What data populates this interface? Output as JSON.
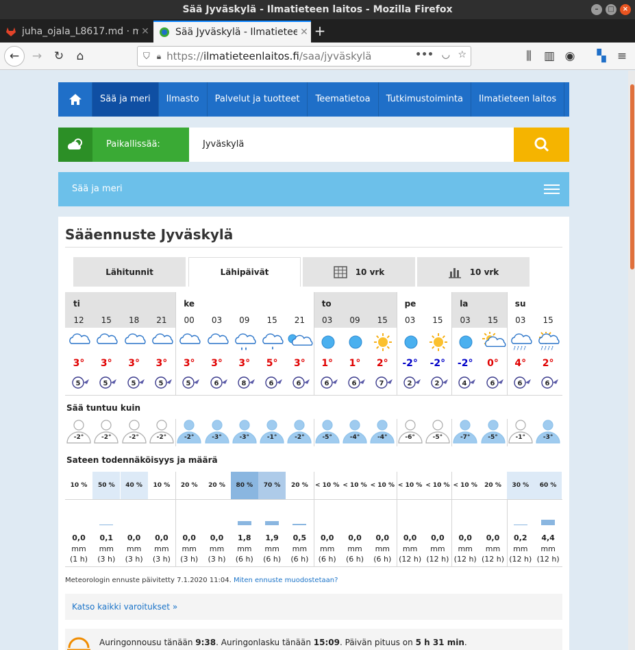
{
  "window": {
    "title": "Sää Jyväskylä - Ilmatieteen laitos - Mozilla Firefox"
  },
  "tabs": [
    {
      "label": "juha_ojala_L8617.md · m"
    },
    {
      "label": "Sää Jyväskylä - Ilmatieteen"
    }
  ],
  "url": {
    "prefix": "https://",
    "host": "ilmatieteenlaitos.fi",
    "path": "/saa/jyväskylä"
  },
  "nav": [
    "Sää ja meri",
    "Ilmasto",
    "Palvelut ja tuotteet",
    "Teematietoa",
    "Tutkimustoiminta",
    "Ilmatieteen laitos"
  ],
  "search": {
    "label": "Paikallissää:",
    "value": "Jyväskylä"
  },
  "section_bar": "Sää ja meri",
  "heading": "Sääennuste Jyväskylä",
  "view_tabs": [
    "Lähitunnit",
    "Lähipäivät",
    "10 vrk",
    "10 vrk"
  ],
  "days": [
    {
      "name": "ti",
      "hours": [
        "12",
        "15",
        "18",
        "21"
      ]
    },
    {
      "name": "ke",
      "hours": [
        "00",
        "03",
        "09",
        "15",
        "21"
      ]
    },
    {
      "name": "to",
      "hours": [
        "03",
        "09",
        "15"
      ]
    },
    {
      "name": "pe",
      "hours": [
        "03",
        "15"
      ]
    },
    {
      "name": "la",
      "hours": [
        "03",
        "15"
      ]
    },
    {
      "name": "su",
      "hours": [
        "03",
        "15"
      ]
    }
  ],
  "columns": [
    {
      "icon": "cloud",
      "temp": "3°",
      "wind": "5",
      "feel": "-2°",
      "feelcol": "#fff",
      "prob": "10 %",
      "amt": "0,0",
      "per": "(1 h)",
      "hi": false,
      "bar": 0
    },
    {
      "icon": "cloud",
      "temp": "3°",
      "wind": "5",
      "feel": "-2°",
      "feelcol": "#fff",
      "prob": "50 %",
      "amt": "0,1",
      "per": "(3 h)",
      "hi": "#ddeaf7",
      "bar": 1
    },
    {
      "icon": "cloud",
      "temp": "3°",
      "wind": "5",
      "feel": "-2°",
      "feelcol": "#fff",
      "prob": "40 %",
      "amt": "0,0",
      "per": "(3 h)",
      "hi": "#ddeaf7",
      "bar": 0
    },
    {
      "icon": "cloud",
      "temp": "3°",
      "wind": "5",
      "feel": "-2°",
      "feelcol": "#fff",
      "prob": "10 %",
      "amt": "0,0",
      "per": "(3 h)",
      "hi": false,
      "bar": 0
    },
    {
      "icon": "cloud",
      "temp": "3°",
      "wind": "5",
      "feel": "-2°",
      "feelcol": "#9fcbef",
      "prob": "20 %",
      "amt": "0,0",
      "per": "(3 h)",
      "hi": false,
      "bar": 0
    },
    {
      "icon": "cloud",
      "temp": "3°",
      "wind": "6",
      "feel": "-3°",
      "feelcol": "#9fcbef",
      "prob": "20 %",
      "amt": "0,0",
      "per": "(3 h)",
      "hi": false,
      "bar": 0
    },
    {
      "icon": "cloud-rain",
      "temp": "3°",
      "wind": "8",
      "feel": "-3°",
      "feelcol": "#9fcbef",
      "prob": "80 %",
      "amt": "1,8",
      "per": "(6 h)",
      "hi": "#8ab6e0",
      "bar": 6
    },
    {
      "icon": "cloud-drop",
      "temp": "5°",
      "wind": "6",
      "feel": "-1°",
      "feelcol": "#9fcbef",
      "prob": "70 %",
      "amt": "1,9",
      "per": "(6 h)",
      "hi": "#aecbe9",
      "bar": 6
    },
    {
      "icon": "moon-cloud",
      "temp": "3°",
      "wind": "6",
      "feel": "-2°",
      "feelcol": "#9fcbef",
      "prob": "20 %",
      "amt": "0,5",
      "per": "(6 h)",
      "hi": false,
      "bar": 2
    },
    {
      "icon": "moon",
      "temp": "1°",
      "wind": "6",
      "feel": "-5°",
      "feelcol": "#9fcbef",
      "prob": "< 10 %",
      "amt": "0,0",
      "per": "(6 h)",
      "hi": false,
      "bar": 0
    },
    {
      "icon": "moon",
      "temp": "1°",
      "wind": "6",
      "feel": "-4°",
      "feelcol": "#9fcbef",
      "prob": "< 10 %",
      "amt": "0,0",
      "per": "(6 h)",
      "hi": false,
      "bar": 0
    },
    {
      "icon": "sun",
      "temp": "2°",
      "wind": "7",
      "feel": "-4°",
      "feelcol": "#9fcbef",
      "prob": "< 10 %",
      "amt": "0,0",
      "per": "(6 h)",
      "hi": false,
      "bar": 0
    },
    {
      "icon": "moon",
      "temp": "-2°",
      "wind": "2",
      "feel": "-6°",
      "feelcol": "#fff",
      "prob": "< 10 %",
      "amt": "0,0",
      "per": "(12 h)",
      "hi": false,
      "bar": 0
    },
    {
      "icon": "sun",
      "temp": "-2°",
      "wind": "2",
      "feel": "-5°",
      "feelcol": "#fff",
      "prob": "< 10 %",
      "amt": "0,0",
      "per": "(12 h)",
      "hi": false,
      "bar": 0
    },
    {
      "icon": "moon",
      "temp": "-2°",
      "wind": "4",
      "feel": "-7°",
      "feelcol": "#9fcbef",
      "prob": "< 10 %",
      "amt": "0,0",
      "per": "(12 h)",
      "hi": false,
      "bar": 0
    },
    {
      "icon": "sun-cloud",
      "temp": "0°",
      "wind": "6",
      "feel": "-5°",
      "feelcol": "#9fcbef",
      "prob": "20 %",
      "amt": "0,0",
      "per": "(12 h)",
      "hi": false,
      "bar": 0
    },
    {
      "icon": "cloud-snow",
      "temp": "4°",
      "wind": "6",
      "feel": "-1°",
      "feelcol": "#fff",
      "prob": "30 %",
      "amt": "0,2",
      "per": "(12 h)",
      "hi": "#ddeaf7",
      "bar": 1
    },
    {
      "icon": "sun-cloud-rain",
      "temp": "2°",
      "wind": "6",
      "feel": "-3°",
      "feelcol": "#9fcbef",
      "prob": "60 %",
      "amt": "4,4",
      "per": "(12 h)",
      "hi": "#ddeaf7",
      "bar": 8
    }
  ],
  "sections": {
    "feels": "Sää tuntuu kuin",
    "precip": "Sateen todennäköisyys ja määrä"
  },
  "mm": "mm",
  "updated": "Meteorologin ennuste päivitetty 7.1.2020 11:04.",
  "updated_link": "Miten ennuste muodostetaan?",
  "warnings_link": "Katso kaikki varoitukset »",
  "sun": {
    "rise_label": "Auringonnousu tänään",
    "rise": "9:38",
    "set_label": ". Auringonlasku tänään",
    "set": "15:09",
    "len_label": ". Päivän pituus on",
    "len": "5 h 31 min",
    "end": "."
  },
  "colors": {
    "warm": "#e00000",
    "cold": "#0000c8",
    "nav": "#1f6fc8",
    "green": "#3aaa35",
    "search_btn": "#f5b400",
    "bar": "#6cc0ea"
  }
}
